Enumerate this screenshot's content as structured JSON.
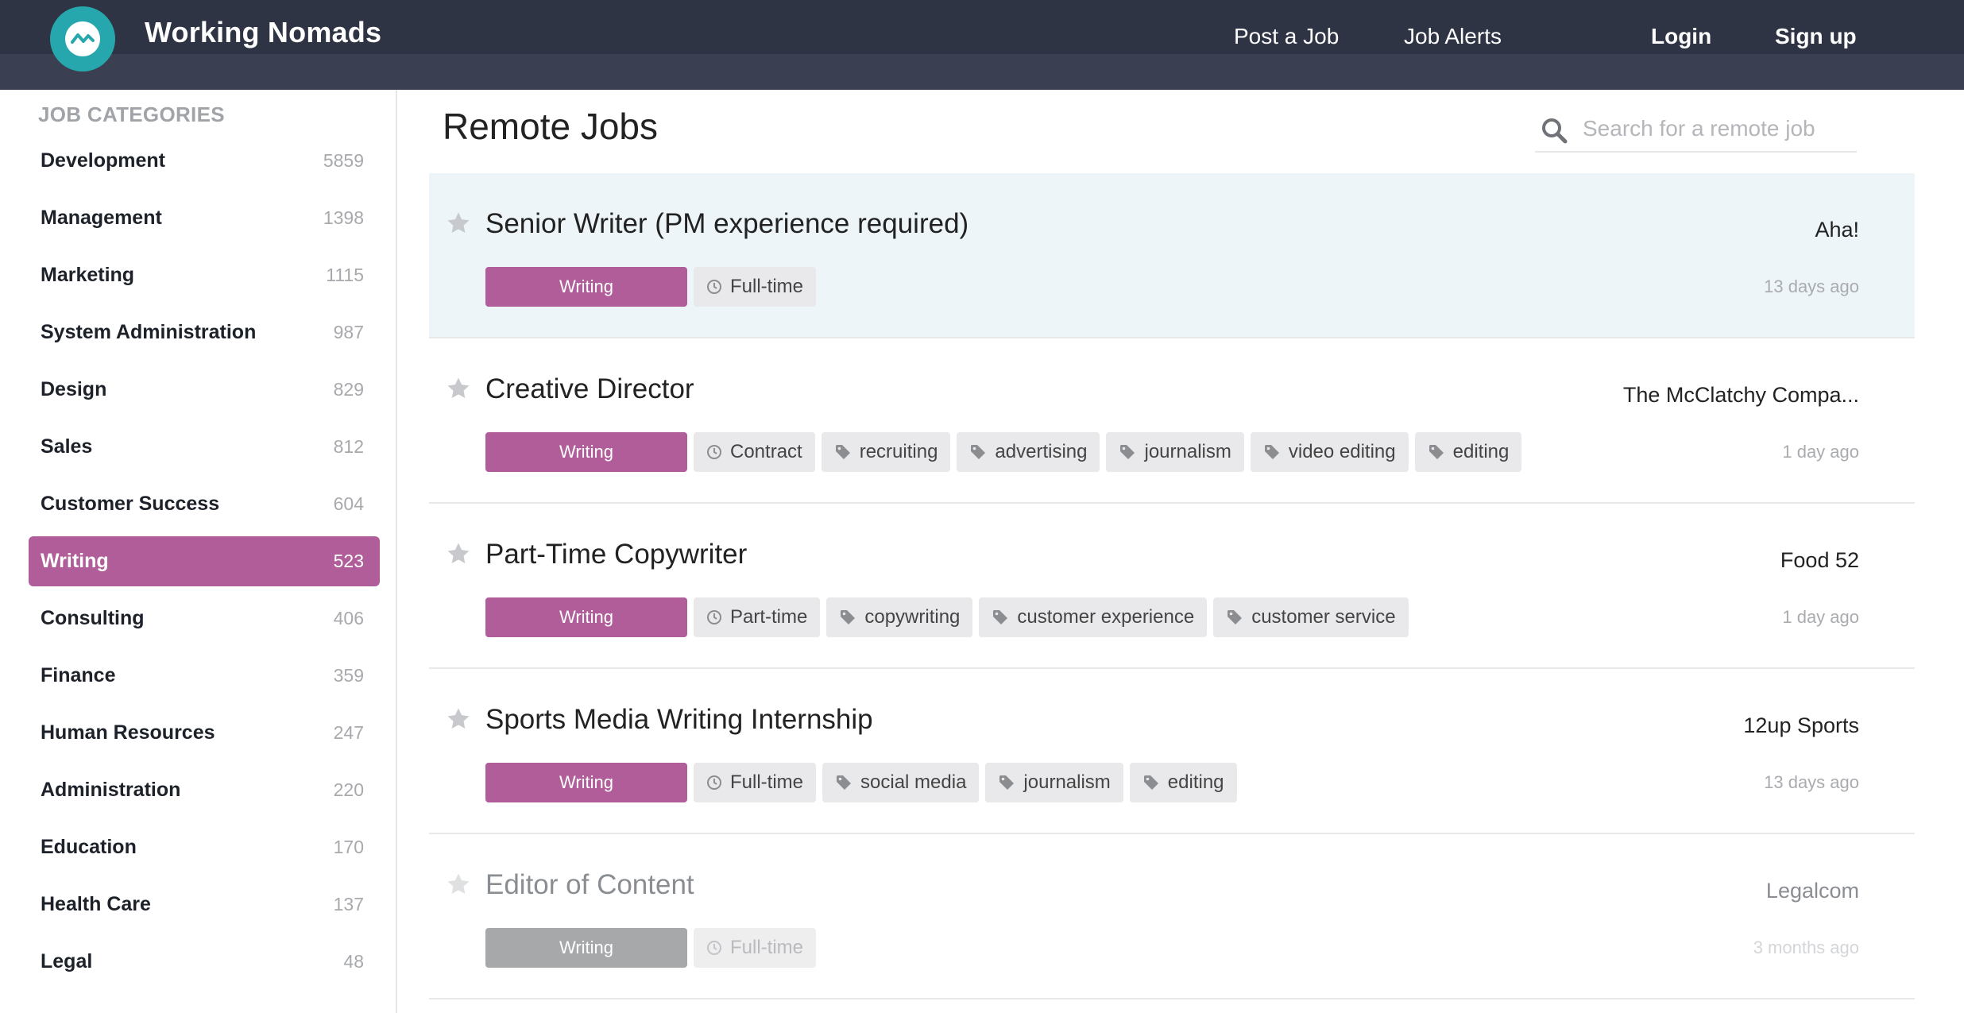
{
  "header": {
    "brand": "Working Nomads",
    "nav": {
      "post_job": "Post a Job",
      "job_alerts": "Job Alerts",
      "login": "Login",
      "signup": "Sign up"
    }
  },
  "sidebar": {
    "title": "JOB CATEGORIES",
    "items": [
      {
        "label": "Development",
        "count": "5859"
      },
      {
        "label": "Management",
        "count": "1398"
      },
      {
        "label": "Marketing",
        "count": "1115"
      },
      {
        "label": "System Administration",
        "count": "987"
      },
      {
        "label": "Design",
        "count": "829"
      },
      {
        "label": "Sales",
        "count": "812"
      },
      {
        "label": "Customer Success",
        "count": "604"
      },
      {
        "label": "Writing",
        "count": "523"
      },
      {
        "label": "Consulting",
        "count": "406"
      },
      {
        "label": "Finance",
        "count": "359"
      },
      {
        "label": "Human Resources",
        "count": "247"
      },
      {
        "label": "Administration",
        "count": "220"
      },
      {
        "label": "Education",
        "count": "170"
      },
      {
        "label": "Health Care",
        "count": "137"
      },
      {
        "label": "Legal",
        "count": "48"
      }
    ],
    "active": "Writing"
  },
  "main": {
    "title": "Remote Jobs",
    "search_placeholder": "Search for a remote job",
    "jobs": [
      {
        "title": "Senior Writer (PM experience required)",
        "company": "Aha!",
        "ago": "13 days ago",
        "category": "Writing",
        "type": "Full-time",
        "tags": []
      },
      {
        "title": "Creative Director",
        "company": "The McClatchy Compa...",
        "ago": "1 day ago",
        "category": "Writing",
        "type": "Contract",
        "tags": [
          "recruiting",
          "advertising",
          "journalism",
          "video editing",
          "editing"
        ]
      },
      {
        "title": "Part-Time Copywriter",
        "company": "Food 52",
        "ago": "1 day ago",
        "category": "Writing",
        "type": "Part-time",
        "tags": [
          "copywriting",
          "customer experience",
          "customer service"
        ]
      },
      {
        "title": "Sports Media Writing Internship",
        "company": "12up Sports",
        "ago": "13 days ago",
        "category": "Writing",
        "type": "Full-time",
        "tags": [
          "social media",
          "journalism",
          "editing"
        ]
      },
      {
        "title": "Editor of Content",
        "company": "Legalcom",
        "ago": "3 months ago",
        "category": "Writing",
        "type": "Full-time",
        "tags": []
      }
    ]
  },
  "colors": {
    "header_bg": "#2f3445",
    "accent_writing": "#b05d9a",
    "logo": "#26a7ad",
    "highlight_row": "#edf5f8"
  },
  "icons": {
    "logo": "wave-circle-icon",
    "search": "search-icon",
    "star": "star-icon",
    "clock": "clock-icon",
    "tag": "tag-icon"
  }
}
